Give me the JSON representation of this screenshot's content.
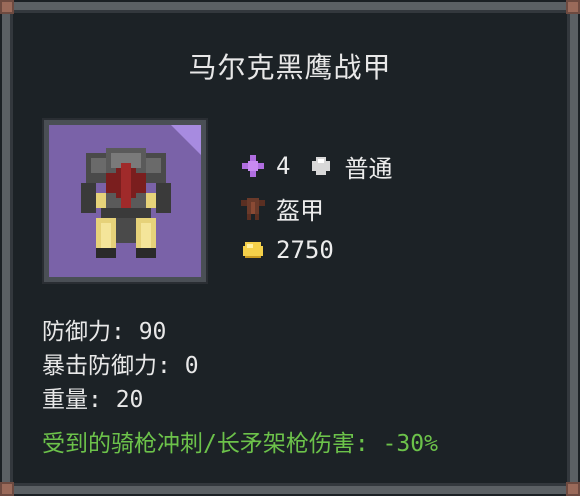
{
  "item": {
    "name": "马尔克黑鹰战甲",
    "tier": "4",
    "quality": "普通",
    "category": "盔甲",
    "price": "2750",
    "stats": {
      "defense": "防御力: 90",
      "crit_defense": "暴击防御力: 0",
      "weight": "重量: 20"
    },
    "special_effect": "受到的骑枪冲刺/长矛架枪伤害: -30%"
  },
  "colors": {
    "tier_icon": "#b06ee0",
    "quality_icon": "#d8d8d8",
    "category_icon": "#6a3a2a",
    "coin_icon": "#f4d04a",
    "special_text": "#6cc24a",
    "icon_bg": "#7a62a8"
  },
  "icons": {
    "tier": "tier-star-icon",
    "quality": "quality-gem-icon",
    "category": "armor-category-icon",
    "price": "gold-coin-icon"
  }
}
